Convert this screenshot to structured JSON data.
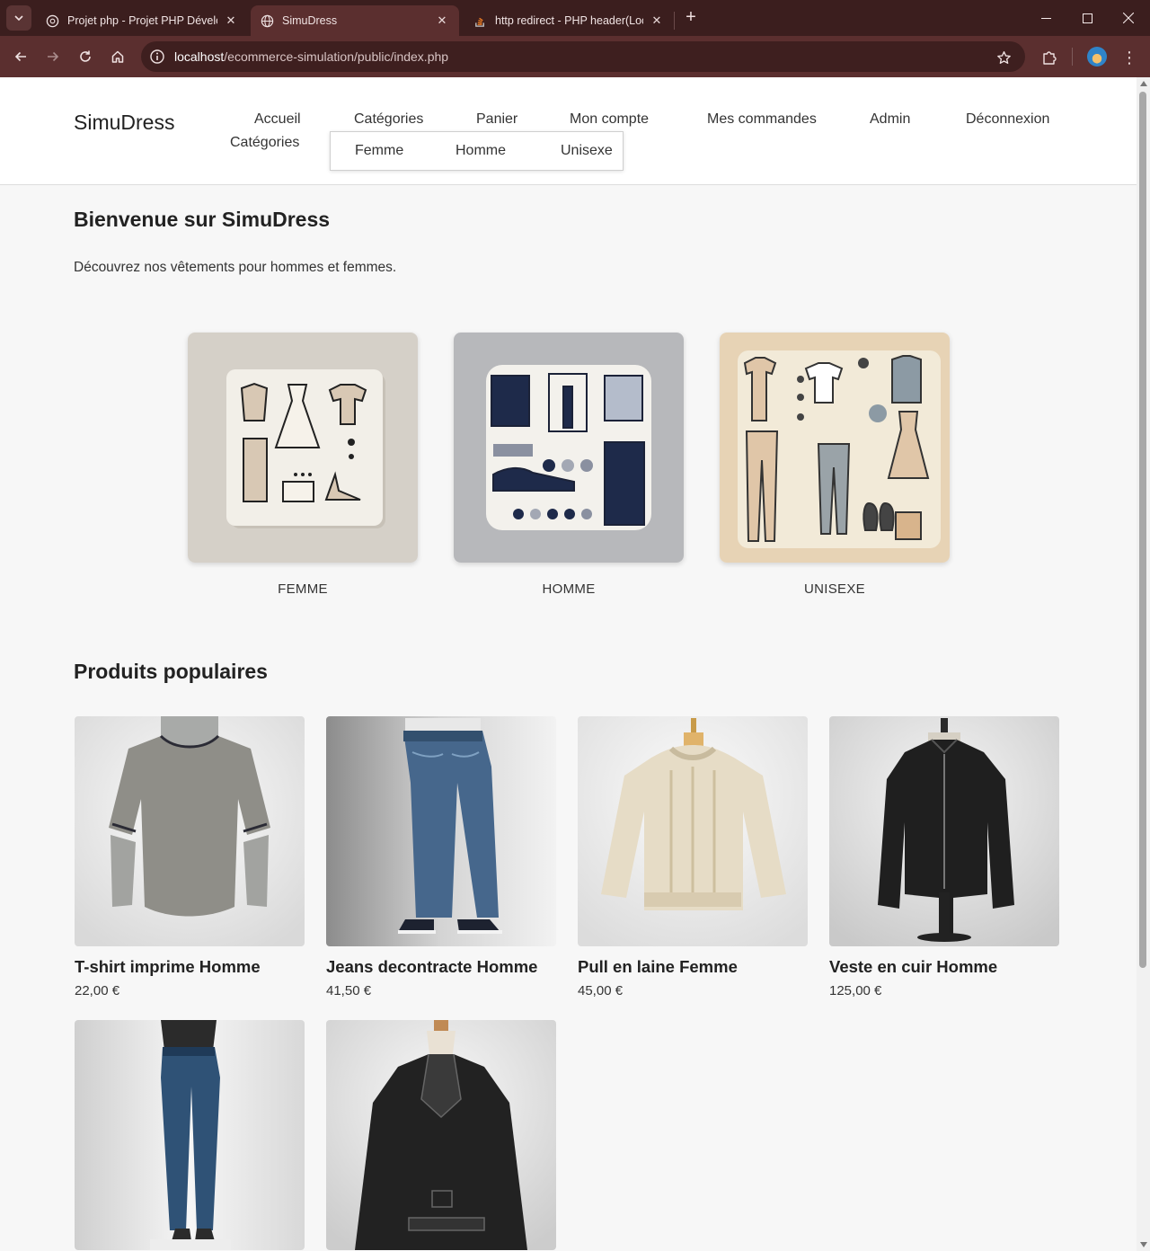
{
  "browser": {
    "tabs": [
      {
        "title": "Projet php - Projet PHP Dévelop"
      },
      {
        "title": "SimuDress"
      },
      {
        "title": "http redirect - PHP header(Loca"
      }
    ],
    "url_host": "localhost",
    "url_path": "/ecommerce-simulation/public/index.php"
  },
  "header": {
    "logo": "SimuDress",
    "nav": {
      "accueil": "Accueil",
      "categories": "Catégories",
      "panier": "Panier",
      "compte": "Mon compte",
      "commandes": "Mes commandes",
      "admin": "Admin",
      "deconnexion": "Déconnexion"
    },
    "nav_sub": "Catégories",
    "dropdown": [
      "Femme",
      "Homme",
      "Unisexe"
    ]
  },
  "welcome": {
    "title": "Bienvenue sur SimuDress",
    "text": "Découvrez nos vêtements pour hommes et femmes."
  },
  "categories": [
    {
      "label": "FEMME",
      "bg": "#d5d0c8"
    },
    {
      "label": "HOMME",
      "bg": "#b7b8bb"
    },
    {
      "label": "UNISEXE",
      "bg": "#e7d3b5"
    }
  ],
  "popular": {
    "title": "Produits populaires",
    "products": [
      {
        "name": "T-shirt imprime Homme",
        "price": "22,00 €"
      },
      {
        "name": "Jeans decontracte Homme",
        "price": "41,50 €"
      },
      {
        "name": "Pull en laine Femme",
        "price": "45,00 €"
      },
      {
        "name": "Veste en cuir Homme",
        "price": "125,00 €"
      },
      {
        "name": "",
        "price": ""
      },
      {
        "name": "",
        "price": ""
      }
    ]
  }
}
